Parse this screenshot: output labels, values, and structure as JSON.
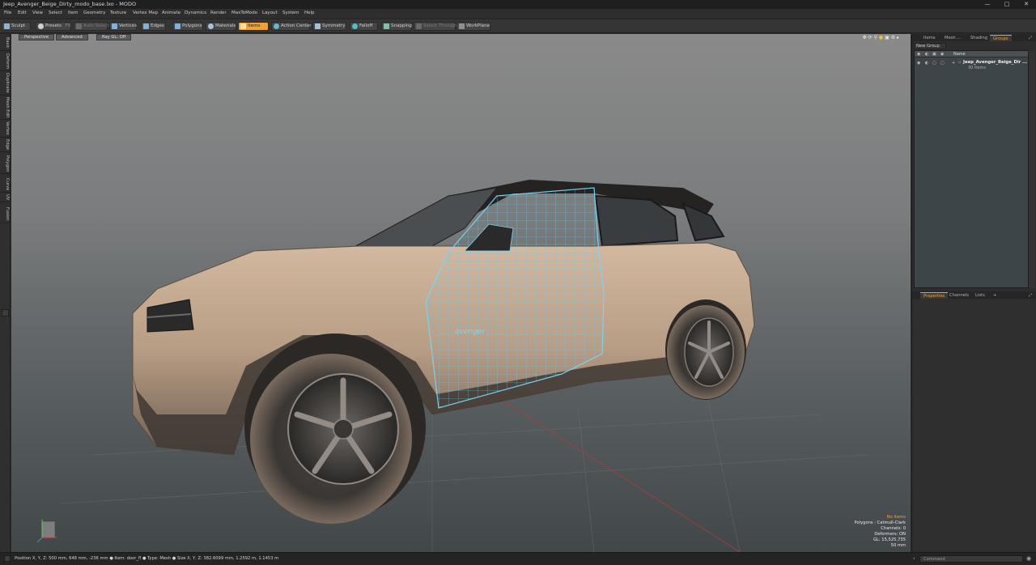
{
  "window": {
    "title": "Jeep_Avenger_Beige_Dirty_modo_base.lxo - MODO",
    "min_icon": "minimize-icon",
    "max_icon": "maximize-icon",
    "close_icon": "close-icon"
  },
  "menu": [
    "File",
    "Edit",
    "View",
    "Select",
    "Item",
    "Geometry",
    "Texture",
    "Vertex Map",
    "Animate",
    "Dynamics",
    "Render",
    "MaxToModo",
    "Layout",
    "System",
    "Help"
  ],
  "toolbar": {
    "sculpt": "Sculpt",
    "presets": "Presets",
    "presets_key": "F6",
    "auto_select": "Auto Select",
    "vertices": "Vertices",
    "edges": "Edges",
    "polygons": "Polygons",
    "materials": "Materials",
    "items": "Items",
    "action_center": "Action Center",
    "symmetry": "Symmetry",
    "falloff": "Falloff",
    "snapping": "Snapping",
    "select_through": "Select Through",
    "workplane": "WorkPlane",
    "accent": "#f0a23a"
  },
  "left_tabs": [
    "Basic",
    "Deform",
    "Duplicate",
    "Mesh Edit",
    "Vertex",
    "Edge",
    "Polygon",
    "Curve",
    "UV",
    "Fusion"
  ],
  "viewport": {
    "view_mode": "Perspective",
    "shading": "Advanced",
    "raygl": "Ray GL: Off",
    "car_badge": "avenger",
    "stats": {
      "no_items": "No Items",
      "polygons": "Polygons : Catmull-Clark",
      "channels": "Channels: 0",
      "deformers": "Deformers: ON",
      "gl": "GL: 15,525,735",
      "scale": "50 mm"
    }
  },
  "right_panel": {
    "tabs": [
      "Items",
      "Mesh ...",
      "Shading",
      "Groups"
    ],
    "active_tab": "Groups",
    "new_group": "New Group",
    "name_header": "Name",
    "group_name": "Jeep_Avenger_Beige_Dir ...",
    "group_count": "30 Items",
    "bottom_tabs": [
      "Properties",
      "Channels",
      "Lists"
    ],
    "bottom_active": "Properties",
    "plus": "+"
  },
  "status": {
    "text": "Position X, Y, Z:  500 mm, 648 mm, -236 mm ●  Item:  door_fl ●  Type:  Mesh ●  Size X, Y, Z:  382.6099 mm, 1.2592 m, 1.1453 m",
    "command_placeholder": "Command"
  }
}
